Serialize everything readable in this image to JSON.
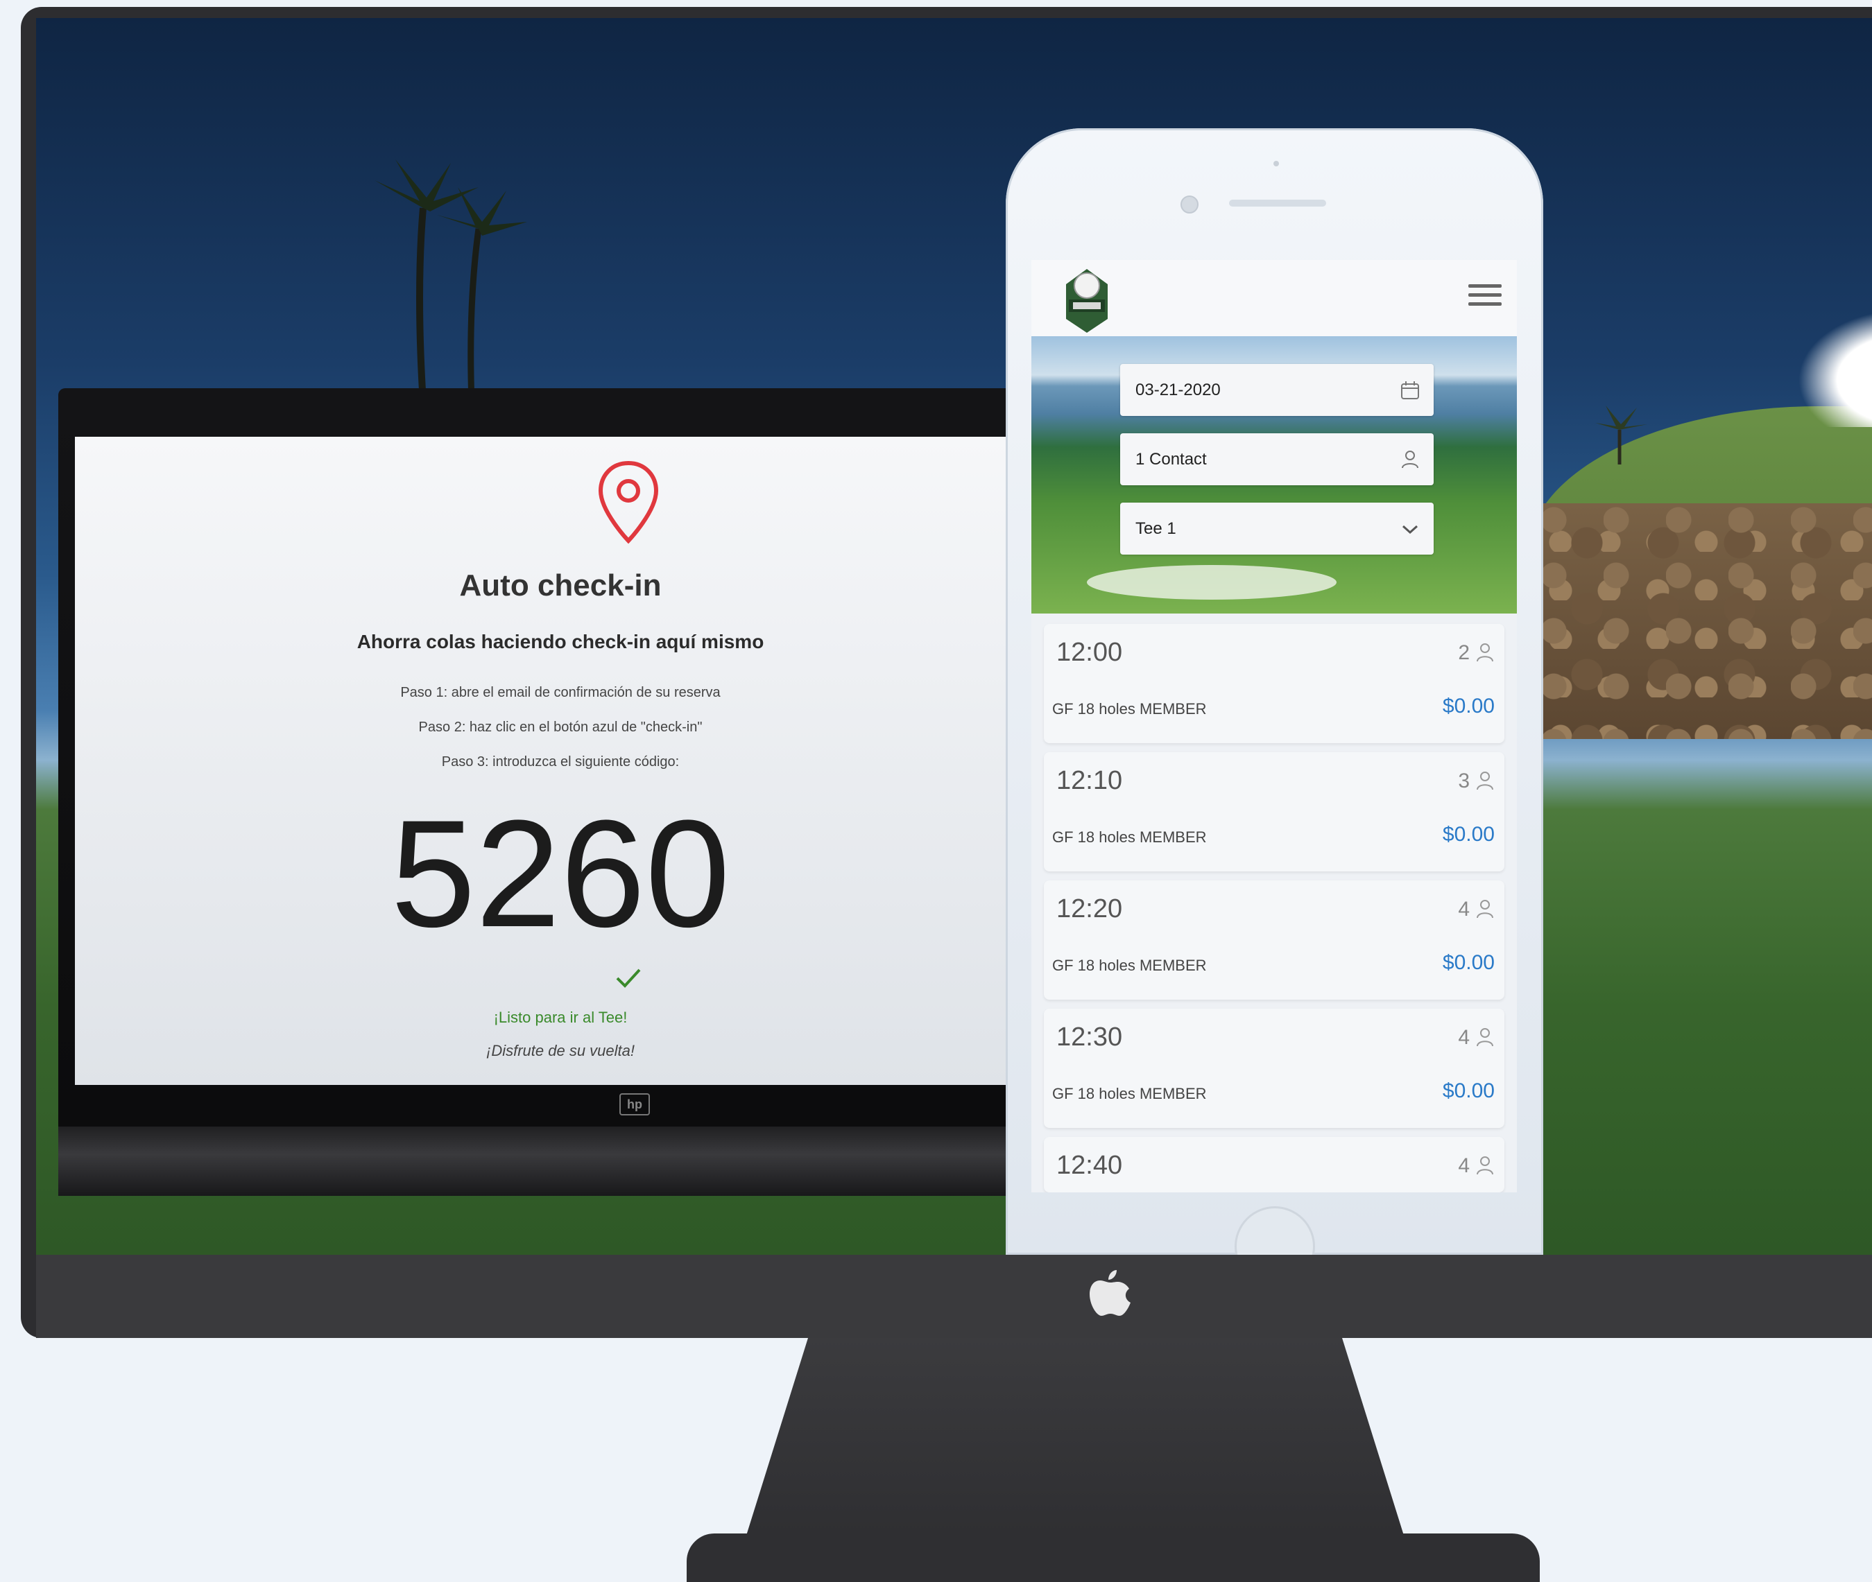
{
  "checkin": {
    "title": "Auto check-in",
    "subtitle": "Ahorra colas haciendo check-in aquí mismo",
    "steps": [
      "Paso 1: abre el email de confirmación de su reserva",
      "Paso 2: haz clic en el botón azul de \"check-in\"",
      "Paso 3: introduzca el siguiente código:"
    ],
    "code": "5260",
    "ready": "¡Listo para ir al Tee!",
    "enjoy": "¡Disfrute de su vuelta!",
    "accent_color": "#e0383e",
    "success_color": "#3a8a2b"
  },
  "booking": {
    "date": "03-21-2020",
    "contact": "1 Contact",
    "tee": "Tee 1",
    "price_color": "#2a7ac8",
    "slots": [
      {
        "time": "12:00",
        "players": "2",
        "rate": "GF 18 holes MEMBER",
        "price": "$0.00"
      },
      {
        "time": "12:10",
        "players": "3",
        "rate": "GF 18 holes MEMBER",
        "price": "$0.00"
      },
      {
        "time": "12:20",
        "players": "4",
        "rate": "GF 18 holes MEMBER",
        "price": "$0.00"
      },
      {
        "time": "12:30",
        "players": "4",
        "rate": "GF 18 holes MEMBER",
        "price": "$0.00"
      },
      {
        "time": "12:40",
        "players": "4"
      }
    ]
  },
  "icons": {
    "location": "location-pin-icon",
    "check": "checkmark-icon",
    "calendar": "calendar-icon",
    "person": "person-icon",
    "dropdown": "chevron-down-icon",
    "menu": "hamburger-menu-icon",
    "apple": "apple-logo-icon"
  }
}
